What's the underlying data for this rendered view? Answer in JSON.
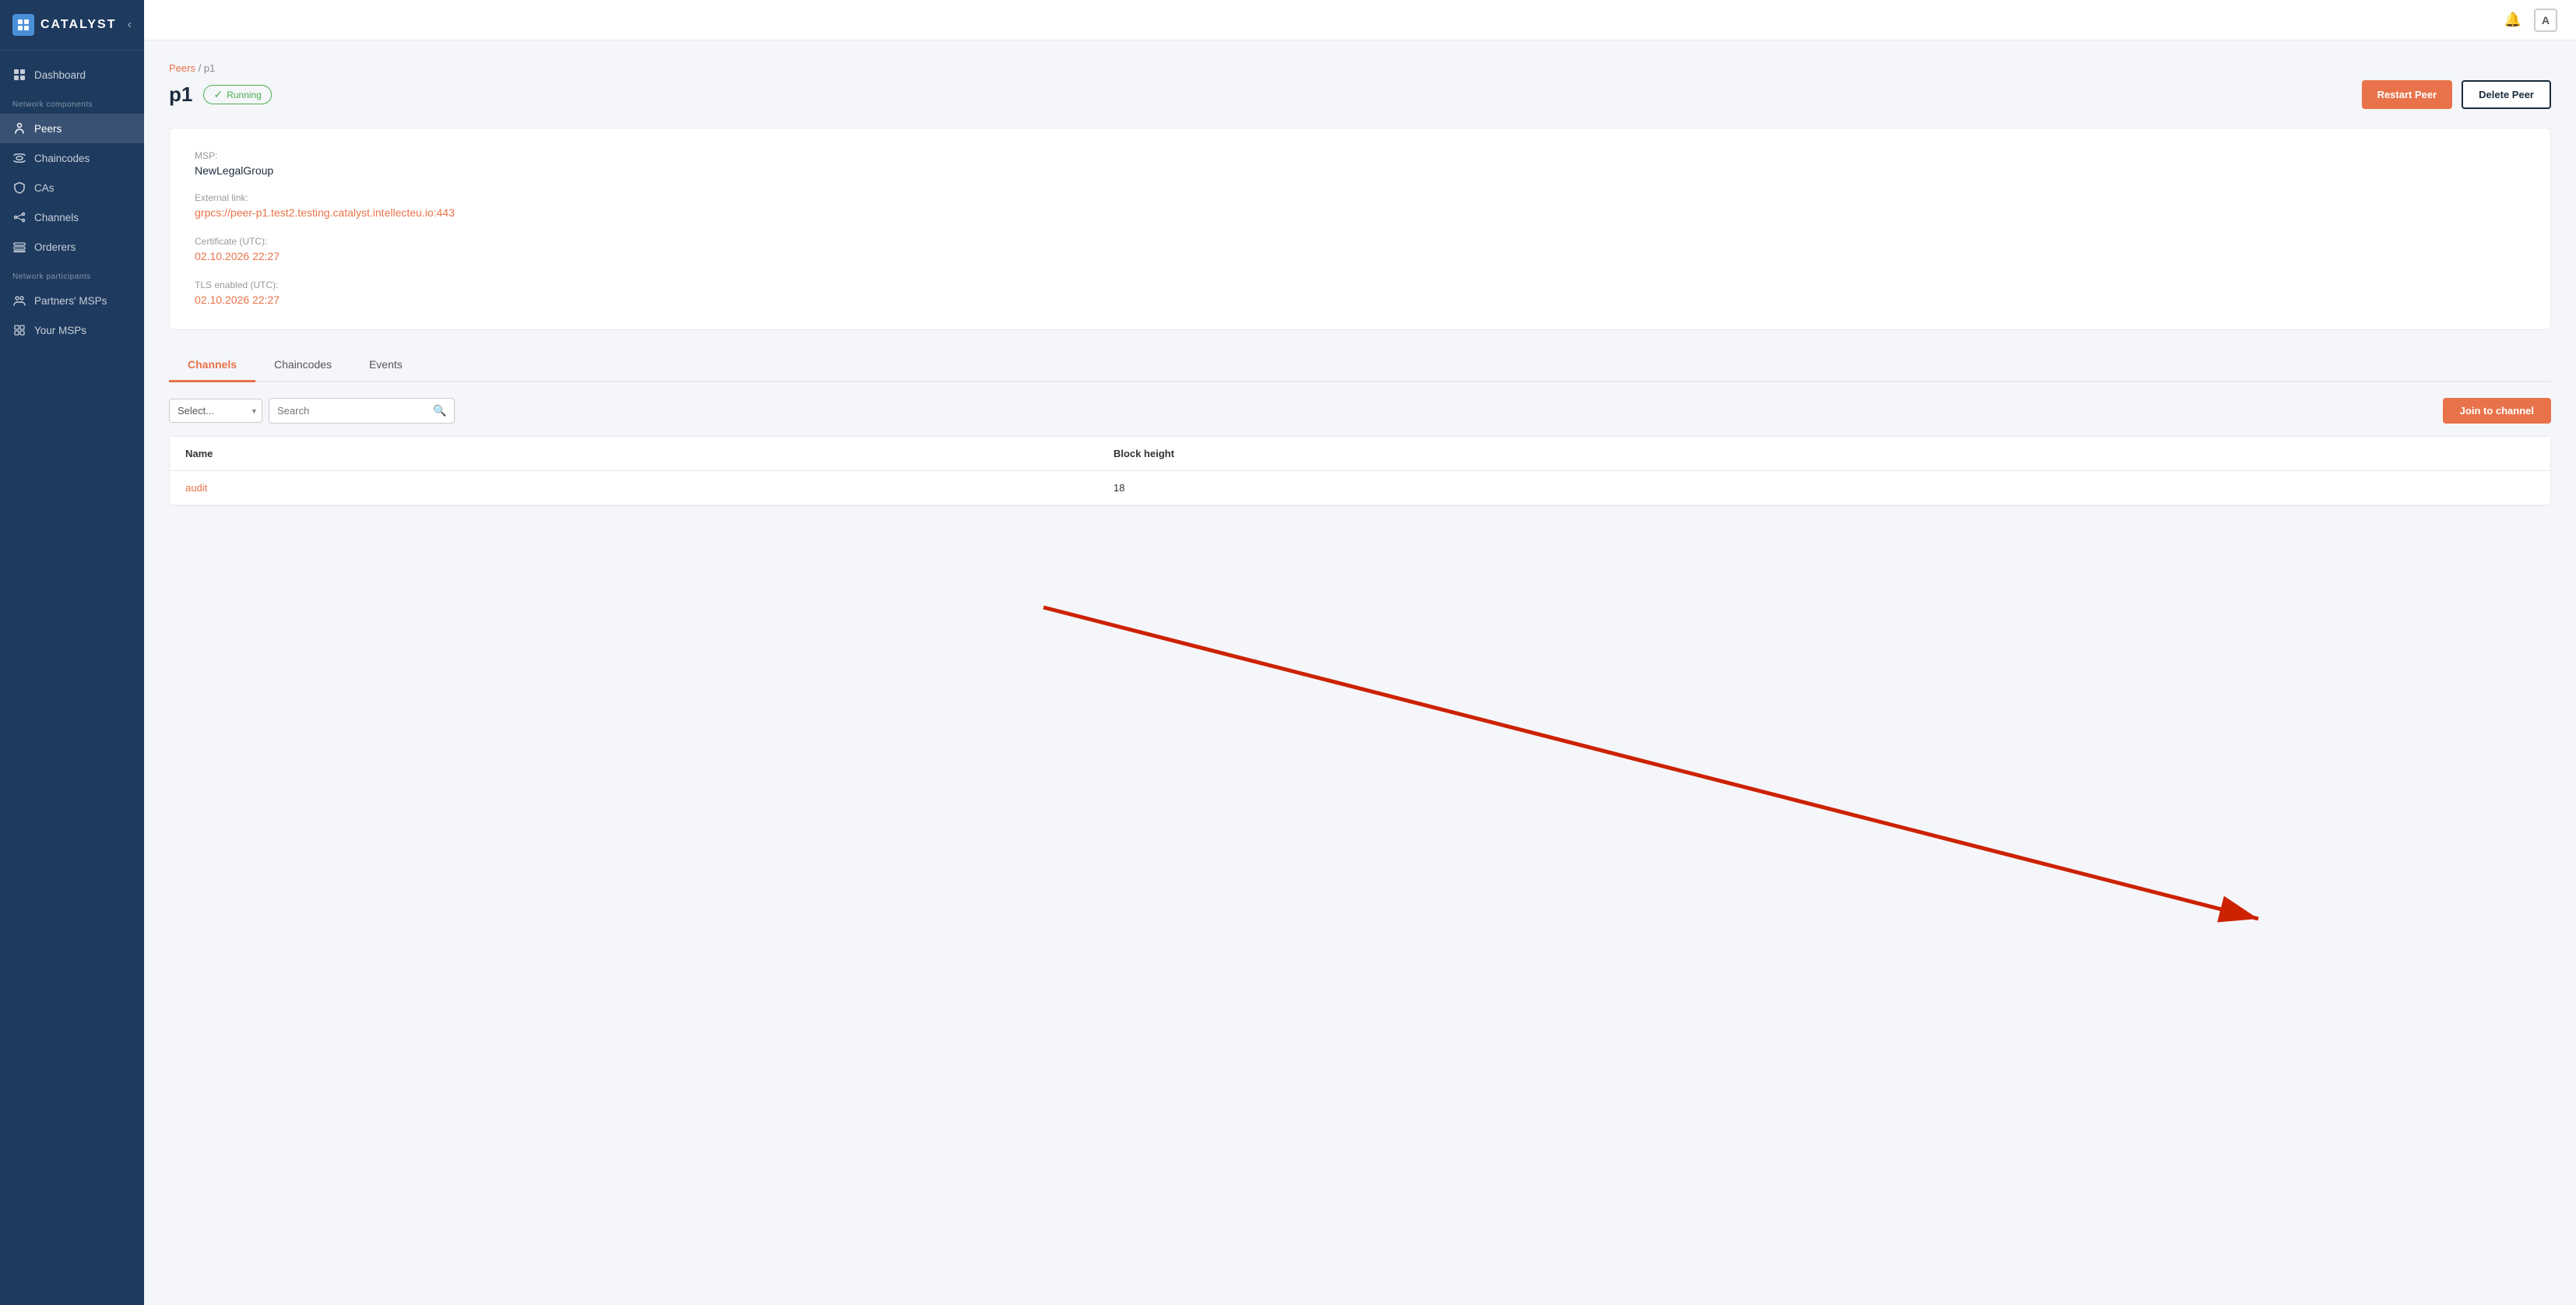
{
  "app": {
    "name": "CATALYST",
    "collapse_label": "‹"
  },
  "sidebar": {
    "section_network_components": "Network components",
    "section_network_participants": "Network participants",
    "items_top": [
      {
        "id": "dashboard",
        "label": "Dashboard",
        "icon": "grid"
      }
    ],
    "items_components": [
      {
        "id": "peers",
        "label": "Peers",
        "icon": "peers",
        "active": true
      },
      {
        "id": "chaincodes",
        "label": "Chaincodes",
        "icon": "chain"
      },
      {
        "id": "cas",
        "label": "CAs",
        "icon": "shield"
      },
      {
        "id": "channels",
        "label": "Channels",
        "icon": "channels"
      },
      {
        "id": "orderers",
        "label": "Orderers",
        "icon": "orderers"
      }
    ],
    "items_participants": [
      {
        "id": "partners-msps",
        "label": "Partners' MSPs",
        "icon": "partners"
      },
      {
        "id": "your-msps",
        "label": "Your MSPs",
        "icon": "yourmsps"
      }
    ]
  },
  "breadcrumb": {
    "parent": "Peers",
    "current": "p1"
  },
  "page": {
    "title": "p1",
    "status": "Running",
    "restart_label": "Restart Peer",
    "delete_label": "Delete Peer"
  },
  "info": {
    "msp_label": "MSP:",
    "msp_value": "NewLegalGroup",
    "external_link_label": "External link:",
    "external_link_value": "grpcs://peer-p1.test2.testing.catalyst.intellecteu.io:443",
    "certificate_label": "Certificate (UTC):",
    "certificate_value": "02.10.2026 22:27",
    "tls_label": "TLS enabled (UTC):",
    "tls_value": "02.10.2026 22:27"
  },
  "tabs": [
    {
      "id": "channels",
      "label": "Channels",
      "active": true
    },
    {
      "id": "chaincodes",
      "label": "Chaincodes",
      "active": false
    },
    {
      "id": "events",
      "label": "Events",
      "active": false
    }
  ],
  "filter": {
    "select_placeholder": "Select...",
    "search_placeholder": "Search",
    "join_label": "Join to channel"
  },
  "table": {
    "columns": [
      "Name",
      "Block height"
    ],
    "rows": [
      {
        "name": "audit",
        "block_height": "18"
      }
    ]
  }
}
